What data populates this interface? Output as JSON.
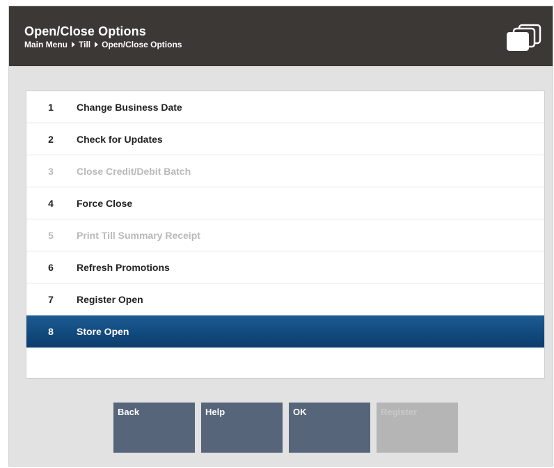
{
  "header": {
    "title": "Open/Close Options",
    "breadcrumb": [
      "Main Menu",
      "Till",
      "Open/Close Options"
    ],
    "icon": "stacked-windows-icon"
  },
  "menu": {
    "items": [
      {
        "num": "1",
        "label": "Change Business Date",
        "state": "enabled"
      },
      {
        "num": "2",
        "label": "Check for Updates",
        "state": "enabled"
      },
      {
        "num": "3",
        "label": "Close Credit/Debit Batch",
        "state": "disabled"
      },
      {
        "num": "4",
        "label": "Force Close",
        "state": "enabled"
      },
      {
        "num": "5",
        "label": "Print Till Summary Receipt",
        "state": "disabled"
      },
      {
        "num": "6",
        "label": "Refresh Promotions",
        "state": "enabled"
      },
      {
        "num": "7",
        "label": "Register Open",
        "state": "enabled"
      },
      {
        "num": "8",
        "label": "Store Open",
        "state": "selected"
      }
    ]
  },
  "buttons": {
    "back": "Back",
    "help": "Help",
    "ok": "OK",
    "register": "Register"
  },
  "colors": {
    "header_bg": "#3b3835",
    "selected_bg": "#124a7e",
    "button_bg": "#56657a",
    "button_disabled_bg": "#b5b5b5",
    "disabled_text": "#b9b9b9"
  }
}
